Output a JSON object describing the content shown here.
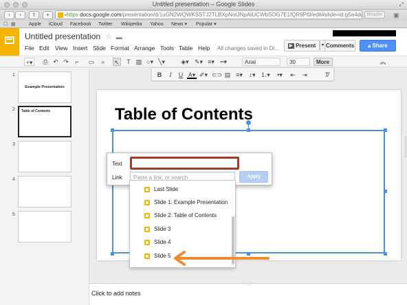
{
  "window": {
    "title": "Untitled presentation – Google Slides"
  },
  "browser": {
    "scheme": "https",
    "url_host": "docs.google.com",
    "url_path": "/presentation/d/1uGN2WQWKSSTJ2TLBXpNotJNpAtUCWbSOG7E1fQR9P6I/edit#slide=id.g5a4dc",
    "reader_label": "Reader",
    "bookmarks": [
      "Apple",
      "iCloud",
      "Facebook",
      "Twitter",
      "Wikipedia",
      "Yahoo",
      "News ▾",
      "Popular ▾"
    ]
  },
  "app": {
    "doc_title": "Untitled presentation",
    "menus": [
      "File",
      "Edit",
      "View",
      "Insert",
      "Slide",
      "Format",
      "Arrange",
      "Tools",
      "Table",
      "Help"
    ],
    "save_status": "All changes saved in Dr...",
    "present_label": "Present",
    "comments_label": "Comments",
    "share_label": "Share"
  },
  "toolbar": {
    "font_name": "Arial",
    "font_size": "30",
    "more_label": "More"
  },
  "filmstrip": {
    "slides": [
      {
        "num": "1",
        "text": "Example Presentation"
      },
      {
        "num": "2",
        "text": "Table of Contents"
      },
      {
        "num": "3",
        "text": ""
      },
      {
        "num": "4",
        "text": ""
      },
      {
        "num": "5",
        "text": ""
      }
    ]
  },
  "slide": {
    "title": "Table of Contents"
  },
  "link_dialog": {
    "text_label": "Text",
    "text_value": "",
    "link_label": "Link",
    "link_placeholder": "Paste a link, or search",
    "apply_label": "Apply"
  },
  "link_options": [
    "Last Slide",
    "Slide 1: Example Presentation",
    "Slide 2: Table of Contents",
    "Slide 3",
    "Slide 4",
    "Slide 5"
  ],
  "notes": {
    "placeholder": "Click to add notes"
  },
  "colors": {
    "accent": "#f4b400",
    "selection": "#4a90e2",
    "share": "#4d90fe",
    "highlight_border": "#a93a23",
    "arrow": "#f08c2e"
  }
}
